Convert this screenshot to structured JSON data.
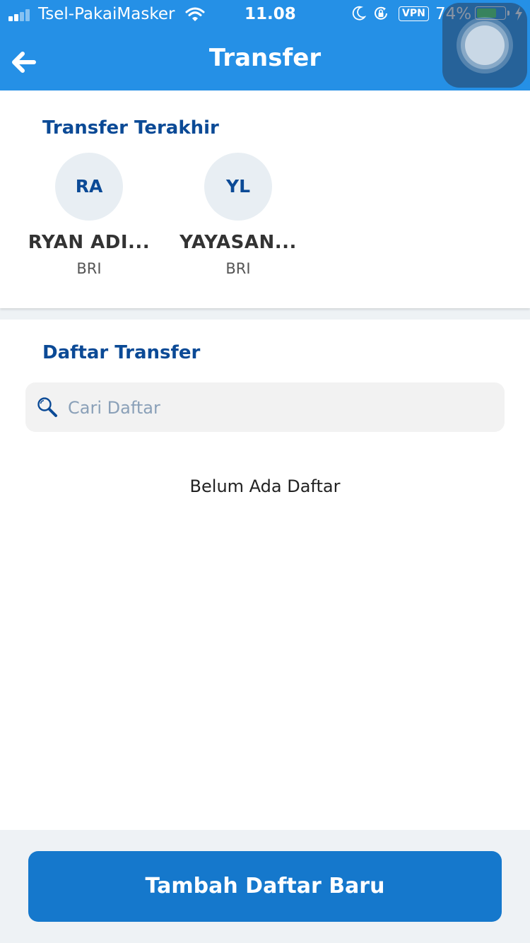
{
  "status_bar": {
    "carrier": "Tsel-PakaiMasker",
    "time": "11.08",
    "vpn": "VPN",
    "battery_percent_label": "74%",
    "battery_level": 0.74,
    "icons": [
      "signal-icon",
      "wifi-icon",
      "moon-icon",
      "orientation-lock-icon",
      "battery-icon",
      "charging-icon"
    ]
  },
  "header": {
    "title": "Transfer",
    "back_icon": "arrow-left-icon"
  },
  "recent": {
    "title": "Transfer Terakhir",
    "items": [
      {
        "initials": "RA",
        "name": "RYAN ADI...",
        "bank": "BRI"
      },
      {
        "initials": "YL",
        "name": "YAYASAN...",
        "bank": "BRI"
      }
    ]
  },
  "list": {
    "title": "Daftar Transfer",
    "search_placeholder": "Cari Daftar",
    "empty_text": "Belum Ada Daftar"
  },
  "actions": {
    "add_label": "Tambah Daftar Baru"
  },
  "colors": {
    "header_bg": "#2590e6",
    "accent_text": "#0b4a96",
    "button_bg": "#1578cc",
    "battery_fill": "#4cd964"
  }
}
